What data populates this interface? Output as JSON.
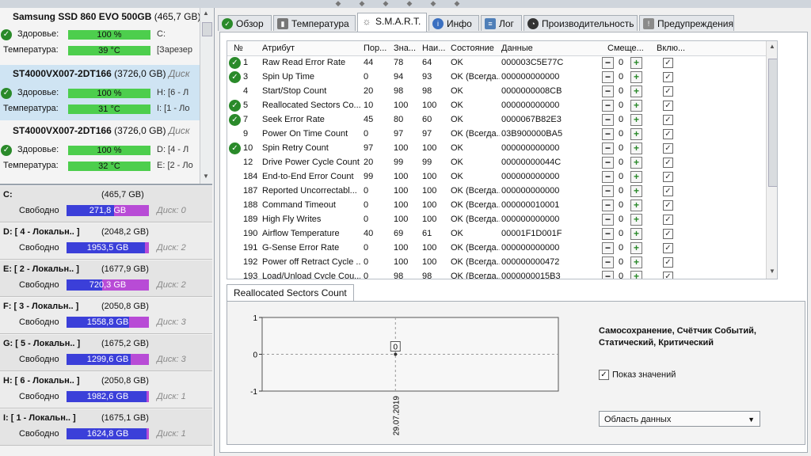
{
  "drives": [
    {
      "name": "Samsung SSD 860 EVO 500GB",
      "capacity": "(465,7 GB)",
      "extra": "",
      "health_label": "Здоровье:",
      "health": "100 %",
      "health_side": "C:",
      "temp_label": "Температура:",
      "temp": "39 °C",
      "temp_side": "[Зарезер",
      "selected": false
    },
    {
      "name": "ST4000VX007-2DT166",
      "capacity": "(3726,0 GB)",
      "extra": "Диск",
      "health_label": "Здоровье:",
      "health": "100 %",
      "health_side": "H: [6 - Л",
      "temp_label": "Температура:",
      "temp": "31 °C",
      "temp_side": "I: [1 - Ло",
      "selected": true
    },
    {
      "name": "ST4000VX007-2DT166",
      "capacity": "(3726,0 GB)",
      "extra": "Диск",
      "health_label": "Здоровье:",
      "health": "100 %",
      "health_side": "D: [4 - Л",
      "temp_label": "Температура:",
      "temp": "32 °C",
      "temp_side": "E: [2 - Ло",
      "selected": false
    }
  ],
  "volumes": [
    {
      "name": "C:",
      "size": "(465,7 GB)",
      "free_label": "Свободно",
      "free": "271,8 GB",
      "free_fraction": 0.58,
      "disk": "Диск: 0"
    },
    {
      "name": "D: [ 4 - Локальн.. ]",
      "size": "(2048,2 GB)",
      "free_label": "Свободно",
      "free": "1953,5 GB",
      "free_fraction": 0.95,
      "disk": "Диск: 2"
    },
    {
      "name": "E: [ 2 - Локальн.. ]",
      "size": "(1677,9 GB)",
      "free_label": "Свободно",
      "free": "720,3 GB",
      "free_fraction": 0.43,
      "disk": "Диск: 2"
    },
    {
      "name": "F: [ 3 - Локальн.. ]",
      "size": "(2050,8 GB)",
      "free_label": "Свободно",
      "free": "1558,8 GB",
      "free_fraction": 0.76,
      "disk": "Диск: 3"
    },
    {
      "name": "G: [ 5 - Локальн.. ]",
      "size": "(1675,2 GB)",
      "free_label": "Свободно",
      "free": "1299,6 GB",
      "free_fraction": 0.78,
      "disk": "Диск: 3"
    },
    {
      "name": "H: [ 6 - Локальн.. ]",
      "size": "(2050,8 GB)",
      "free_label": "Свободно",
      "free": "1982,6 GB",
      "free_fraction": 0.97,
      "disk": "Диск: 1"
    },
    {
      "name": "I: [ 1 - Локальн.. ]",
      "size": "(1675,1 GB)",
      "free_label": "Свободно",
      "free": "1624,8 GB",
      "free_fraction": 0.97,
      "disk": "Диск: 1"
    }
  ],
  "tabs": [
    {
      "label": "Обзор",
      "icon": "check-icon",
      "active": false
    },
    {
      "label": "Температура",
      "icon": "thermometer-icon",
      "active": false
    },
    {
      "label": "S.M.A.R.T.",
      "icon": "smart-icon",
      "active": true
    },
    {
      "label": "Инфо",
      "icon": "info-icon",
      "active": false
    },
    {
      "label": "Лог",
      "icon": "log-icon",
      "active": false
    },
    {
      "label": "Производительность",
      "icon": "performance-icon",
      "active": false
    },
    {
      "label": "Предупреждения",
      "icon": "warning-icon",
      "active": false
    }
  ],
  "smart": {
    "headers": {
      "num": "№",
      "attr": "Атрибут",
      "thr": "Пор...",
      "val": "Зна...",
      "worst": "Наи...",
      "state": "Состояние",
      "data": "Данные",
      "offset": "Смеще...",
      "enabled": "Вклю..."
    },
    "rows": [
      {
        "ok": true,
        "num": "1",
        "attr": "Raw Read Error Rate",
        "thr": "44",
        "val": "78",
        "worst": "64",
        "state": "OK",
        "data": "000003C5E77C",
        "offset": "0",
        "enabled": true
      },
      {
        "ok": true,
        "num": "3",
        "attr": "Spin Up Time",
        "thr": "0",
        "val": "94",
        "worst": "93",
        "state": "OK (Всегда...",
        "data": "000000000000",
        "offset": "0",
        "enabled": true
      },
      {
        "ok": false,
        "num": "4",
        "attr": "Start/Stop Count",
        "thr": "20",
        "val": "98",
        "worst": "98",
        "state": "OK",
        "data": "0000000008CB",
        "offset": "0",
        "enabled": true
      },
      {
        "ok": true,
        "num": "5",
        "attr": "Reallocated Sectors Co...",
        "thr": "10",
        "val": "100",
        "worst": "100",
        "state": "OK",
        "data": "000000000000",
        "offset": "0",
        "enabled": true
      },
      {
        "ok": true,
        "num": "7",
        "attr": "Seek Error Rate",
        "thr": "45",
        "val": "80",
        "worst": "60",
        "state": "OK",
        "data": "0000067B82E3",
        "offset": "0",
        "enabled": true
      },
      {
        "ok": false,
        "num": "9",
        "attr": "Power On Time Count",
        "thr": "0",
        "val": "97",
        "worst": "97",
        "state": "OK (Всегда...",
        "data": "03B900000BA5",
        "offset": "0",
        "enabled": true
      },
      {
        "ok": true,
        "num": "10",
        "attr": "Spin Retry Count",
        "thr": "97",
        "val": "100",
        "worst": "100",
        "state": "OK",
        "data": "000000000000",
        "offset": "0",
        "enabled": true
      },
      {
        "ok": false,
        "num": "12",
        "attr": "Drive Power Cycle Count",
        "thr": "20",
        "val": "99",
        "worst": "99",
        "state": "OK",
        "data": "00000000044C",
        "offset": "0",
        "enabled": true
      },
      {
        "ok": false,
        "num": "184",
        "attr": "End-to-End Error Count",
        "thr": "99",
        "val": "100",
        "worst": "100",
        "state": "OK",
        "data": "000000000000",
        "offset": "0",
        "enabled": true
      },
      {
        "ok": false,
        "num": "187",
        "attr": "Reported Uncorrectabl...",
        "thr": "0",
        "val": "100",
        "worst": "100",
        "state": "OK (Всегда...",
        "data": "000000000000",
        "offset": "0",
        "enabled": true
      },
      {
        "ok": false,
        "num": "188",
        "attr": "Command Timeout",
        "thr": "0",
        "val": "100",
        "worst": "100",
        "state": "OK (Всегда...",
        "data": "000000010001",
        "offset": "0",
        "enabled": true
      },
      {
        "ok": false,
        "num": "189",
        "attr": "High Fly Writes",
        "thr": "0",
        "val": "100",
        "worst": "100",
        "state": "OK (Всегда...",
        "data": "000000000000",
        "offset": "0",
        "enabled": true
      },
      {
        "ok": false,
        "num": "190",
        "attr": "Airflow Temperature",
        "thr": "40",
        "val": "69",
        "worst": "61",
        "state": "OK",
        "data": "00001F1D001F",
        "offset": "0",
        "enabled": true
      },
      {
        "ok": false,
        "num": "191",
        "attr": "G-Sense Error Rate",
        "thr": "0",
        "val": "100",
        "worst": "100",
        "state": "OK (Всегда...",
        "data": "000000000000",
        "offset": "0",
        "enabled": true
      },
      {
        "ok": false,
        "num": "192",
        "attr": "Power off Retract Cycle ...",
        "thr": "0",
        "val": "100",
        "worst": "100",
        "state": "OK (Всегда...",
        "data": "000000000472",
        "offset": "0",
        "enabled": true
      },
      {
        "ok": false,
        "num": "193",
        "attr": "Load/Unload Cycle Cou...",
        "thr": "0",
        "val": "98",
        "worst": "98",
        "state": "OK (Всегда...",
        "data": "0000000015B3",
        "offset": "0",
        "enabled": true
      }
    ]
  },
  "chart_panel": {
    "tab_label": "Reallocated Sectors Count",
    "legend_text": "Самосохранение, Счётчик Событий, Статический, Критический",
    "show_values_label": "Показ значений",
    "show_values_checked": true,
    "combo_value": "Область данных"
  },
  "chart_data": {
    "type": "line",
    "x": [
      "29.07.2019"
    ],
    "series": [
      {
        "values": [
          0
        ]
      }
    ],
    "ylim": [
      -1,
      1
    ],
    "yticks": [
      "1",
      "0",
      "-1"
    ],
    "point_label": "0"
  },
  "colors": {
    "health_bar": "#4dce4d",
    "used_space": "#b84bd6",
    "free_space": "#3b3fd9",
    "ok": "#2a8a2a"
  }
}
